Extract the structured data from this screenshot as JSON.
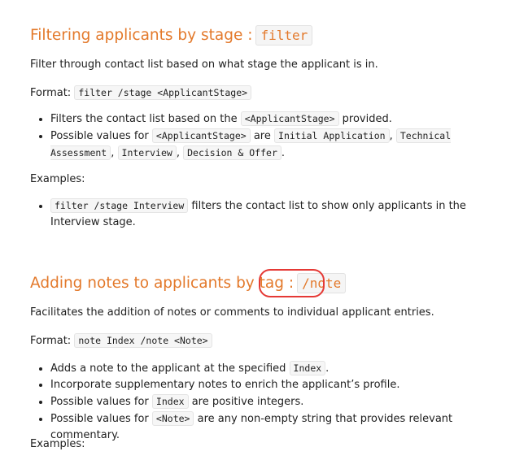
{
  "filter_section": {
    "heading_text": "Filtering applicants by stage :",
    "heading_code": "filter",
    "description": "Filter through contact list based on what stage the applicant is in.",
    "format_label": "Format:",
    "format_code": "filter /stage <ApplicantStage>",
    "bullets": {
      "b1_pre": "Filters the contact list based on the",
      "b1_code": "<ApplicantStage>",
      "b1_post": "provided.",
      "b2_pre": "Possible values for",
      "b2_code": "<ApplicantStage>",
      "b2_mid": "are",
      "b2_v1": "Initial Application",
      "b2_v2": "Technical Assessment",
      "b2_v3": "Interview",
      "b2_v4": "Decision & Offer"
    },
    "examples_label": "Examples:",
    "example": {
      "code": "filter /stage Interview",
      "text": "filters the contact list to show only applicants in the Interview stage."
    }
  },
  "note_section": {
    "heading_text": "Adding notes to applicants by tag :",
    "heading_code": "/note",
    "description": "Facilitates the addition of notes or comments to individual applicant entries.",
    "format_label": "Format:",
    "format_code": "note Index /note <Note>",
    "bullets": {
      "b1_pre": "Adds a note to the applicant at the specified",
      "b1_code": "Index",
      "b2": "Incorporate supplementary notes to enrich the applicant’s profile.",
      "b3_pre": "Possible values for",
      "b3_code": "Index",
      "b3_post": "are positive integers.",
      "b4_pre": "Possible values for",
      "b4_code": "<Note>",
      "b4_post": "are any non-empty string that provides relevant commentary."
    },
    "examples_label": "Examples:"
  },
  "colors": {
    "heading": "#e3792b",
    "highlight_ring": "#e53935"
  }
}
